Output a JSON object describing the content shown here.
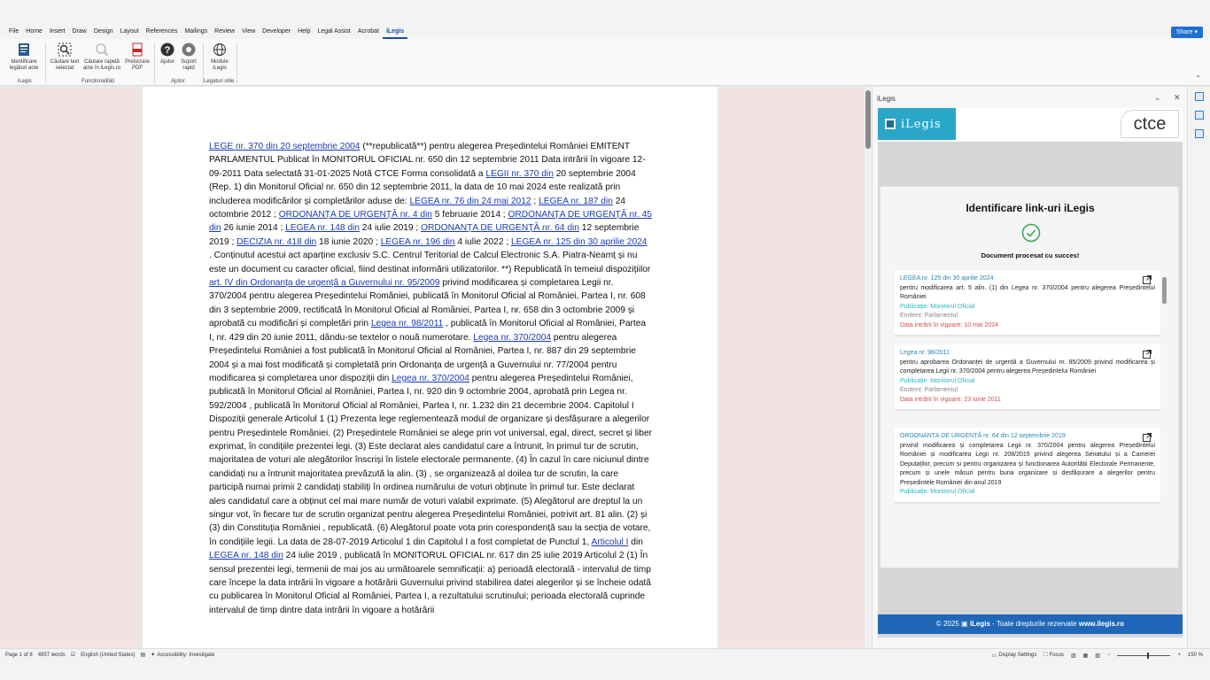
{
  "menubar": {
    "tabs": [
      "File",
      "Home",
      "Insert",
      "Draw",
      "Design",
      "Layout",
      "References",
      "Mailings",
      "Review",
      "View",
      "Developer",
      "Help",
      "Legal Assist",
      "Acrobat",
      "iLegis"
    ],
    "active": "iLegis",
    "share_label": "Share"
  },
  "ribbon": {
    "buttons": {
      "identificare": "Identificare legături acte",
      "cautare_text": "Căutare text selectat",
      "cautare_rapida": "Căutare rapidă acte în iLegis.ro",
      "prelucrare": "Prelucrare PDF",
      "ajutor": "Ajutor",
      "suport": "Suport rapid",
      "module": "Module iLegis"
    },
    "groups": {
      "ilegis": "iLegis",
      "functionalitati": "Funcționalități",
      "ajutor": "Ajutor",
      "legaturi": "Legaturi utile"
    }
  },
  "document": {
    "segments": [
      {
        "t": "LEGE nr. 370 din 20 septembrie 2004",
        "link": true
      },
      {
        "t": " (**republicată**) pentru alegerea Președintelui României EMITENT PARLAMENTUL Publicat în MONITORUL OFICIAL nr. 650 din 12 septembrie 2011 Data intrării în vigoare 12-09-2011 Data selectată 31-01-2025 Notă CTCE Forma consolidată a "
      },
      {
        "t": "LEGII nr. 370 din",
        "link": true
      },
      {
        "t": " 20 septembrie 2004 (Rep. 1) din Monitorul Oficial nr. 650 din 12 septembrie 2011, la data de 10 mai 2024 este realizată prin includerea modificărilor și completărilor aduse de: "
      },
      {
        "t": "LEGEA nr. 76 din 24 mai 2012",
        "link": true
      },
      {
        "t": " ; "
      },
      {
        "t": "LEGEA nr. 187 din",
        "link": true
      },
      {
        "t": " 24 octombrie 2012 ; "
      },
      {
        "t": "ORDONANȚA DE URGENȚĂ nr. 4 din",
        "link": true
      },
      {
        "t": " 5 februarie 2014 ; "
      },
      {
        "t": "ORDONANȚA DE URGENȚĂ nr. 45 din",
        "link": true
      },
      {
        "t": " 26 iunie 2014 ; "
      },
      {
        "t": "LEGEA nr. 148 din",
        "link": true
      },
      {
        "t": " 24 iulie 2019 ; "
      },
      {
        "t": "ORDONANȚA DE URGENȚĂ nr. 64 din",
        "link": true
      },
      {
        "t": " 12 septembrie 2019 ; "
      },
      {
        "t": "DECIZIA nr. 418 din",
        "link": true
      },
      {
        "t": " 18 iunie 2020 ; "
      },
      {
        "t": "LEGEA nr. 196 din",
        "link": true
      },
      {
        "t": " 4 iulie 2022 ; "
      },
      {
        "t": "LEGEA nr. 125 din 30 aprilie 2024",
        "link": true
      },
      {
        "t": " . Conținutul acestui act aparține exclusiv S.C. Centrul Teritorial de Calcul Electronic S.A. Piatra-Neamț și nu este un document cu caracter oficial, fiind destinat informării utilizatorilor. **) Republicată în temeiul dispozițiilor "
      },
      {
        "t": "art. IV din Ordonanța de urgență a Guvernului nr. 95/2009",
        "link": true
      },
      {
        "t": " privind modificarea și completarea Legii nr. 370/2004 pentru alegerea Președintelui României, publicată în Monitorul Oficial al României, Partea I, nr. 608 din 3 septembrie 2009, rectificată în Monitorul Oficial al României, Partea I, nr. 658 din 3 octombrie 2009 și aprobată cu modificări și completări prin "
      },
      {
        "t": "Legea nr. 98/2011",
        "link": true
      },
      {
        "t": " , publicată în Monitorul Oficial al României, Partea I, nr. 429 din 20 iunie 2011, dându-se textelor o nouă numerotare. "
      },
      {
        "t": "Legea nr. 370/2004",
        "link": true
      },
      {
        "t": " pentru alegerea Președintelui României a fost publicată în Monitorul Oficial al României, Partea I, nr. 887 din 29 septembrie 2004 și a mai fost modificată și completată prin Ordonanța de urgență a Guvernului nr. 77/2004 pentru modificarea și completarea unor dispoziții din "
      },
      {
        "t": "Legea nr. 370/2004",
        "link": true
      },
      {
        "t": " pentru alegerea Președintelui României, publicată în Monitorul Oficial al României, Partea I, nr. 920 din 9 octombrie 2004, aprobată prin Legea nr. 592/2004 , publicată în Monitorul Oficial al României, Partea I, nr. 1.232 din 21 decembrie 2004. Capitolul I Dispoziții generale Articolul 1 (1) Prezenta lege reglementează modul de organizare și desfășurare a alegerilor pentru Președintele României. (2) Președintele României se alege prin vot universal, egal, direct, secret și liber exprimat, în condițiile prezentei legi. (3) Este declarat ales candidatul care a întrunit, în primul tur de scrutin, majoritatea de voturi ale alegătorilor înscriși în listele electorale permanente. (4) În cazul în care niciunul dintre candidați nu a întrunit majoritatea prevăzută la alin. (3) , se organizează al doilea tur de scrutin, la care participă numai primii 2 candidați stabiliți în ordinea numărului de voturi obținute în primul tur. Este declarat ales candidatul care a obținut cel mai mare număr de voturi valabil exprimate. (5) Alegătorul are dreptul la un singur vot, în fiecare tur de scrutin organizat pentru alegerea Președintelui României, potrivit art. 81 alin. (2) și (3) din Constituția României , republicată. (6) Alegătorul poate vota prin corespondență sau la secția de votare, în condițiile legii. La data de 28-07-2019 Articolul 1 din Capitolul I a fost completat de Punctul 1, "
      },
      {
        "t": "Articolul I",
        "link": true
      },
      {
        "t": " din "
      },
      {
        "t": "LEGEA nr. 148 din",
        "link": true
      },
      {
        "t": " 24 iulie 2019 , publicată în MONITORUL OFICIAL nr. 617 din 25 iulie 2019 Articolul 2 (1) În sensul prezentei legi, termenii de mai jos au următoarele semnificații: a) perioadă electorală - intervalul de timp care începe la data intrării în vigoare a hotărârii Guvernului privind stabilirea datei alegerilor și se încheie odată cu publicarea în Monitorul Oficial al României, Partea I, a rezultatului scrutinului; perioada electorală cuprinde intervalul de timp dintre data intrării în vigoare a hotărârii"
      }
    ]
  },
  "pane": {
    "title": "iLegis",
    "brand_left": "iLegis",
    "brand_right": "ctce",
    "heading": "Identificare link-uri iLegis",
    "status": "Document procesat cu succes!",
    "items": [
      {
        "title": "LEGEA nr. 125 din 30 aprilie 2024",
        "desc": "pentru modificarea art. 5 alin. (1) din Legea nr. 370/2004 pentru alegerea Președintelui României",
        "pub": "Publicație: Monitorul Oficial",
        "emitent": "Emitent: Parlamentul",
        "vigoare": "Data intrării în vigoare: 10 mai 2024"
      },
      {
        "title": "Legea nr. 98/2011",
        "desc": "pentru aprobarea Ordonanței de urgență a Guvernului nr. 95/2009 privind modificarea și completarea Legii nr. 370/2004 pentru alegerea Președintelui României",
        "pub": "Publicație: Monitorul Oficial",
        "emitent": "Emitent: Parlamentul",
        "vigoare": "Data intrării în vigoare: 23 iunie 2011"
      },
      {
        "title": "ORDONANȚA DE URGENȚĂ nr. 64 din 12 septembrie 2019",
        "desc": "privind modificarea și completarea Legii nr. 370/2004 pentru alegerea Președintelui României și modificarea Legii nr. 208/2015 privind alegerea Senatului și a Camerei Deputaților, precum și pentru organizarea și funcționarea Autorității Electorale Permanente, precum și unele măsuri pentru buna organizare și desfășurare a alegerilor pentru Președintele României din anul 2019",
        "pub": "Publicație: Monitorul Oficial"
      }
    ],
    "footer_pre": "© 2025",
    "footer_brand": "iLegis",
    "footer_mid": " - Toate drepturile rezervate ",
    "footer_url": "www.ilegis.ro"
  },
  "statusbar": {
    "page": "Page 1 of 8",
    "words": "4957 words",
    "language": "English (United States)",
    "accessibility": "Accessibility: Investigate",
    "display": "Display Settings",
    "focus": "Focus",
    "zoom": "150 %"
  }
}
